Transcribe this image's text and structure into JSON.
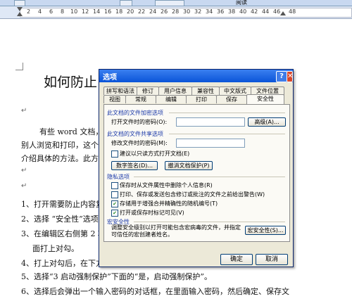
{
  "toolbar": {
    "reading_label": "阅读"
  },
  "ruler": {
    "ticks": [
      "2",
      "4",
      "6",
      "8",
      "10",
      "12",
      "14",
      "16",
      "18",
      "20",
      "22",
      "24",
      "26",
      "28",
      "30",
      "32",
      "34",
      "36",
      "38",
      "40",
      "42",
      "44",
      "46",
      "48"
    ]
  },
  "document": {
    "title": "如何防止",
    "lines": [
      "有些 word 文档，",
      "别人浏览和打印，这个",
      "介绍具体的方法。此方",
      "1、打开需要防止内容复",
      "2、选择 “安全性”选项",
      "3、在编辑区右侧第 2 项",
      "面打上对勾。",
      "4、打上对勾后，在下方",
      "5、选择“3 启动强制保护”下面的“是，启动强制保护”。",
      "6、选择后会弹出一个输入密码的对话框，在里面输入密码，然后确定、保存文"
    ],
    "para_mark": "↵"
  },
  "dialog": {
    "title": "选项",
    "help_btn": "?",
    "close_btn": "✕",
    "tabs_row1": [
      "拼写和语法",
      "修订",
      "用户信息",
      "兼容性",
      "中文版式",
      "文件位置"
    ],
    "tabs_row2": [
      "视图",
      "常规",
      "编辑",
      "打印",
      "保存",
      "安全性"
    ],
    "active_tab": "安全性",
    "encrypt": {
      "section": "此文档的文件加密选项",
      "open_password_label": "打开文件时的密码(O):",
      "advanced_btn": "高级(A)..."
    },
    "share": {
      "section": "此文档的文件共享选项",
      "modify_password_label": "修改文件时的密码(M):",
      "readonly_label": "建议以只读方式打开文档(E)",
      "digital_sig_btn": "数字签名(D)...",
      "protect_btn": "撤消文档保护(P)"
    },
    "privacy": {
      "section": "隐私选项",
      "options": [
        {
          "label": "保存时从文件属性中删除个人信息(R)",
          "checked": false
        },
        {
          "label": "打印、保存或发送包含修订或批注的文件之前给出警告(W)",
          "checked": false
        },
        {
          "label": "存储用于增强合并精确性的随机编号(T)",
          "checked": true
        },
        {
          "label": "打开或保存时标记可见(V)",
          "checked": true
        }
      ]
    },
    "macro": {
      "section": "宏安全性",
      "description": "调整安全级别以打开可能包含宏病毒的文件，并指定可信任的宏创建者姓名。",
      "macro_btn": "宏安全性(S)..."
    },
    "ok_btn": "确定",
    "cancel_btn": "取消"
  }
}
